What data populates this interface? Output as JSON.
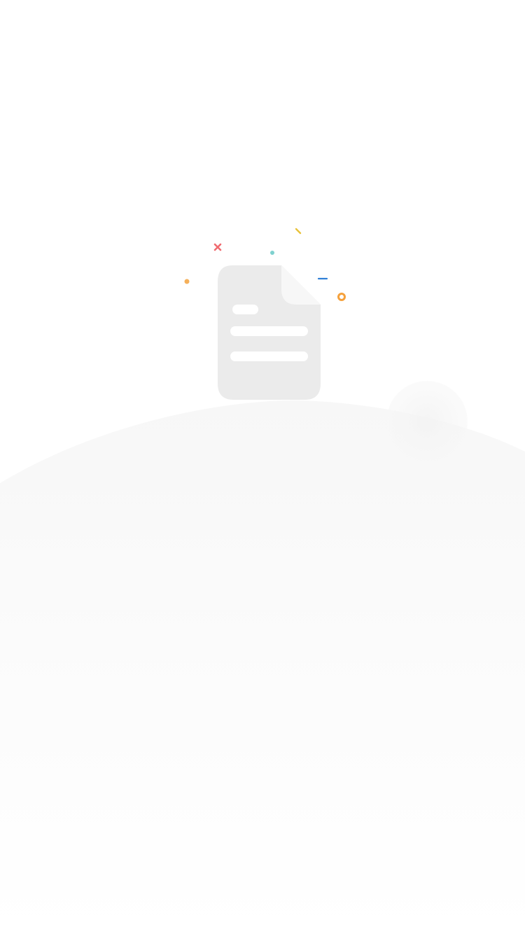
{
  "empty_state": {
    "illustration_icon": "document-icon",
    "decorations": [
      "cross-icon",
      "dot-icon",
      "dash-icon",
      "ring-icon"
    ],
    "colors": {
      "document_fill": "#ebebeb",
      "document_fold": "#f7f7f7",
      "document_lines": "#ffffff",
      "hill_top": "#f7f7f7",
      "hill_bottom": "#ffffff",
      "accent_red": "#f06b70",
      "accent_teal": "#7fd1cf",
      "accent_yellow": "#e8c23a",
      "accent_blue": "#2f7fd6",
      "accent_orange": "#f5a13c",
      "accent_dot_orange": "#f5b05a"
    }
  }
}
